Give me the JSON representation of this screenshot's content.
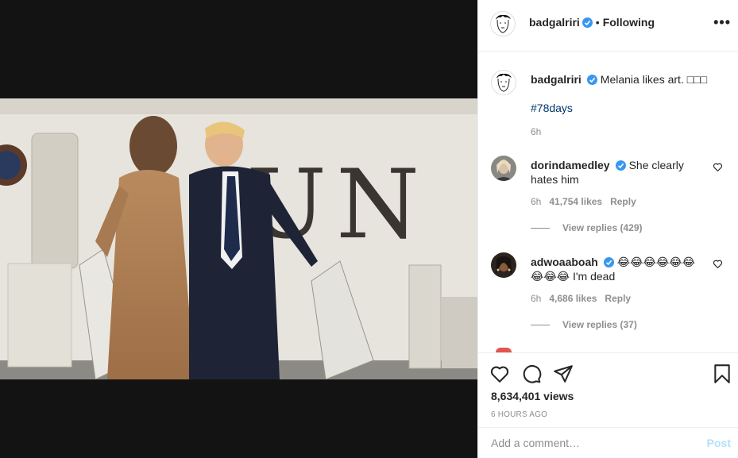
{
  "post": {
    "username": "badgalriri",
    "follow_dot": "•",
    "follow_status": "Following",
    "more": "•••"
  },
  "caption": {
    "username": "badgalriri",
    "text": "Melania likes art. □□□",
    "hashtag": "#78days",
    "time": "6h"
  },
  "comments": [
    {
      "username": "dorindamedley",
      "text": "She clearly hates him",
      "time": "6h",
      "likes": "41,754 likes",
      "reply": "Reply",
      "view_replies": "View replies (429)"
    },
    {
      "username": "adwoaaboah",
      "text": "😂😂😂😂😂😂😂😂😂 I'm dead",
      "time": "6h",
      "likes": "4,686 likes",
      "reply": "Reply",
      "view_replies": "View replies (37)"
    }
  ],
  "stats": {
    "views": "8,634,401 views",
    "time_ago": "6 HOURS AGO"
  },
  "add_comment": {
    "placeholder": "Add a comment…",
    "post_label": "Post"
  },
  "icons": {
    "like": "heart-icon",
    "comment": "comment-icon",
    "share": "share-icon",
    "save": "bookmark-icon",
    "verified": "verified-badge-icon",
    "more": "more-options-icon"
  },
  "colors": {
    "verified": "#3897f0",
    "link": "#00376b",
    "muted": "#8e8e8e",
    "post_disabled": "#b2dffc"
  }
}
